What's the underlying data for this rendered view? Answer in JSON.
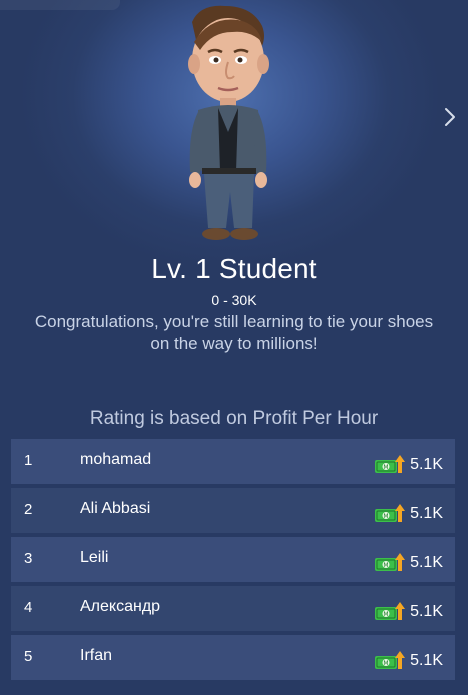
{
  "level": {
    "title": "Lv. 1 Student",
    "range": "0 - 30K",
    "description": "Congratulations, you're still learning to tie your shoes on the way to millions!"
  },
  "rating_note": "Rating is based on Profit Per Hour",
  "icons": {
    "next": "chevron-right-icon",
    "profit": "cash-up-icon",
    "avatar": "character-avatar"
  },
  "colors": {
    "background": "#283a63",
    "row": "#3a4d7a",
    "cash_green": "#3cbf4a",
    "arrow_orange": "#f5a623"
  },
  "leaderboard": [
    {
      "rank": "1",
      "name": "mohamad",
      "profit": "5.1K"
    },
    {
      "rank": "2",
      "name": "Ali Abbasi",
      "profit": "5.1K"
    },
    {
      "rank": "3",
      "name": "Leili",
      "profit": "5.1K"
    },
    {
      "rank": "4",
      "name": "Александр",
      "profit": "5.1K"
    },
    {
      "rank": "5",
      "name": "Irfan",
      "profit": "5.1K"
    }
  ]
}
